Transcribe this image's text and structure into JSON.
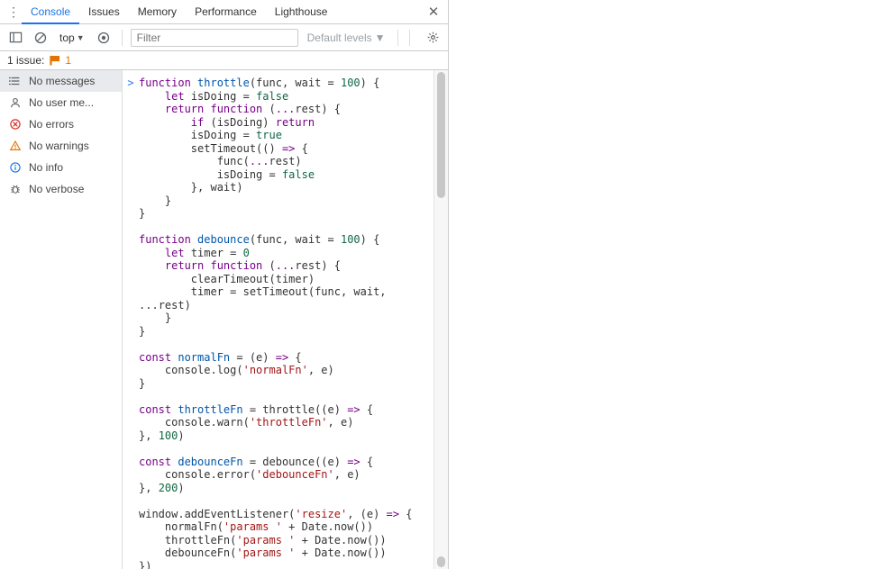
{
  "tabs": {
    "console": "Console",
    "issues": "Issues",
    "memory": "Memory",
    "performance": "Performance",
    "lighthouse": "Lighthouse"
  },
  "toolbar": {
    "context": "top",
    "filter_placeholder": "Filter",
    "levels": "Default levels"
  },
  "issuesbar": {
    "label": "1 issue:",
    "count": "1"
  },
  "sidebar": {
    "nomsg": "No messages",
    "nouser": "No user me...",
    "noerr": "No errors",
    "nowarn": "No warnings",
    "noinfo": "No info",
    "noverb": "No verbose"
  },
  "gutter_prompt": ">",
  "code_segments": [
    [
      [
        "kw",
        "function "
      ],
      [
        "blue",
        "throttle"
      ],
      [
        "op",
        "(func, wait = "
      ],
      [
        "num",
        "100"
      ],
      [
        "op",
        ") {"
      ]
    ],
    [
      [
        "op",
        "    "
      ],
      [
        "kw",
        "let "
      ],
      [
        "op",
        "isDoing = "
      ],
      [
        "bool",
        "false"
      ]
    ],
    [
      [
        "op",
        "    "
      ],
      [
        "kw",
        "return function "
      ],
      [
        "op",
        "("
      ],
      [
        "purple",
        "..."
      ],
      [
        "op",
        "rest) {"
      ]
    ],
    [
      [
        "op",
        "        "
      ],
      [
        "kw",
        "if "
      ],
      [
        "op",
        "(isDoing) "
      ],
      [
        "kw",
        "return"
      ]
    ],
    [
      [
        "op",
        "        isDoing = "
      ],
      [
        "bool",
        "true"
      ]
    ],
    [
      [
        "op",
        "        setTimeout(() "
      ],
      [
        "purple",
        "=>"
      ],
      [
        "op",
        " {"
      ]
    ],
    [
      [
        "op",
        "            func("
      ],
      [
        "purple",
        "..."
      ],
      [
        "op",
        "rest)"
      ]
    ],
    [
      [
        "op",
        "            isDoing = "
      ],
      [
        "bool",
        "false"
      ]
    ],
    [
      [
        "op",
        "        }, wait)"
      ]
    ],
    [
      [
        "op",
        "    }"
      ]
    ],
    [
      [
        "op",
        "}"
      ]
    ],
    [
      [
        "op",
        ""
      ]
    ],
    [
      [
        "kw",
        "function "
      ],
      [
        "blue",
        "debounce"
      ],
      [
        "op",
        "(func, wait = "
      ],
      [
        "num",
        "100"
      ],
      [
        "op",
        ") {"
      ]
    ],
    [
      [
        "op",
        "    "
      ],
      [
        "kw",
        "let "
      ],
      [
        "op",
        "timer = "
      ],
      [
        "num",
        "0"
      ]
    ],
    [
      [
        "op",
        "    "
      ],
      [
        "kw",
        "return function "
      ],
      [
        "op",
        "("
      ],
      [
        "purple",
        "..."
      ],
      [
        "op",
        "rest) {"
      ]
    ],
    [
      [
        "op",
        "        clearTimeout(timer)"
      ]
    ],
    [
      [
        "op",
        "        timer = setTimeout(func, wait,"
      ]
    ],
    [
      [
        "op",
        "..."
      ],
      [
        "op",
        "rest)"
      ]
    ],
    [
      [
        "op",
        "    }"
      ]
    ],
    [
      [
        "op",
        "}"
      ]
    ],
    [
      [
        "op",
        ""
      ]
    ],
    [
      [
        "kw",
        "const "
      ],
      [
        "blue",
        "normalFn"
      ],
      [
        "op",
        " = (e) "
      ],
      [
        "purple",
        "=>"
      ],
      [
        "op",
        " {"
      ]
    ],
    [
      [
        "op",
        "    console.log("
      ],
      [
        "red",
        "'normalFn'"
      ],
      [
        "op",
        ", e)"
      ]
    ],
    [
      [
        "op",
        "}"
      ]
    ],
    [
      [
        "op",
        ""
      ]
    ],
    [
      [
        "kw",
        "const "
      ],
      [
        "blue",
        "throttleFn"
      ],
      [
        "op",
        " = throttle((e) "
      ],
      [
        "purple",
        "=>"
      ],
      [
        "op",
        " {"
      ]
    ],
    [
      [
        "op",
        "    console.warn("
      ],
      [
        "red",
        "'throttleFn'"
      ],
      [
        "op",
        ", e)"
      ]
    ],
    [
      [
        "op",
        "}, "
      ],
      [
        "num",
        "100"
      ],
      [
        "op",
        ")"
      ]
    ],
    [
      [
        "op",
        ""
      ]
    ],
    [
      [
        "kw",
        "const "
      ],
      [
        "blue",
        "debounceFn"
      ],
      [
        "op",
        " = debounce((e) "
      ],
      [
        "purple",
        "=>"
      ],
      [
        "op",
        " {"
      ]
    ],
    [
      [
        "op",
        "    console.error("
      ],
      [
        "red",
        "'debounceFn'"
      ],
      [
        "op",
        ", e)"
      ]
    ],
    [
      [
        "op",
        "}, "
      ],
      [
        "num",
        "200"
      ],
      [
        "op",
        ")"
      ]
    ],
    [
      [
        "op",
        ""
      ]
    ],
    [
      [
        "op",
        "window.addEventListener("
      ],
      [
        "red",
        "'resize'"
      ],
      [
        "op",
        ", (e) "
      ],
      [
        "purple",
        "=>"
      ],
      [
        "op",
        " {"
      ]
    ],
    [
      [
        "op",
        "    normalFn("
      ],
      [
        "red",
        "'params '"
      ],
      [
        "op",
        " + Date.now())"
      ]
    ],
    [
      [
        "op",
        "    throttleFn("
      ],
      [
        "red",
        "'params '"
      ],
      [
        "op",
        " + Date.now())"
      ]
    ],
    [
      [
        "op",
        "    debounceFn("
      ],
      [
        "red",
        "'params '"
      ],
      [
        "op",
        " + Date.now())"
      ]
    ],
    [
      [
        "op",
        "})"
      ]
    ]
  ]
}
